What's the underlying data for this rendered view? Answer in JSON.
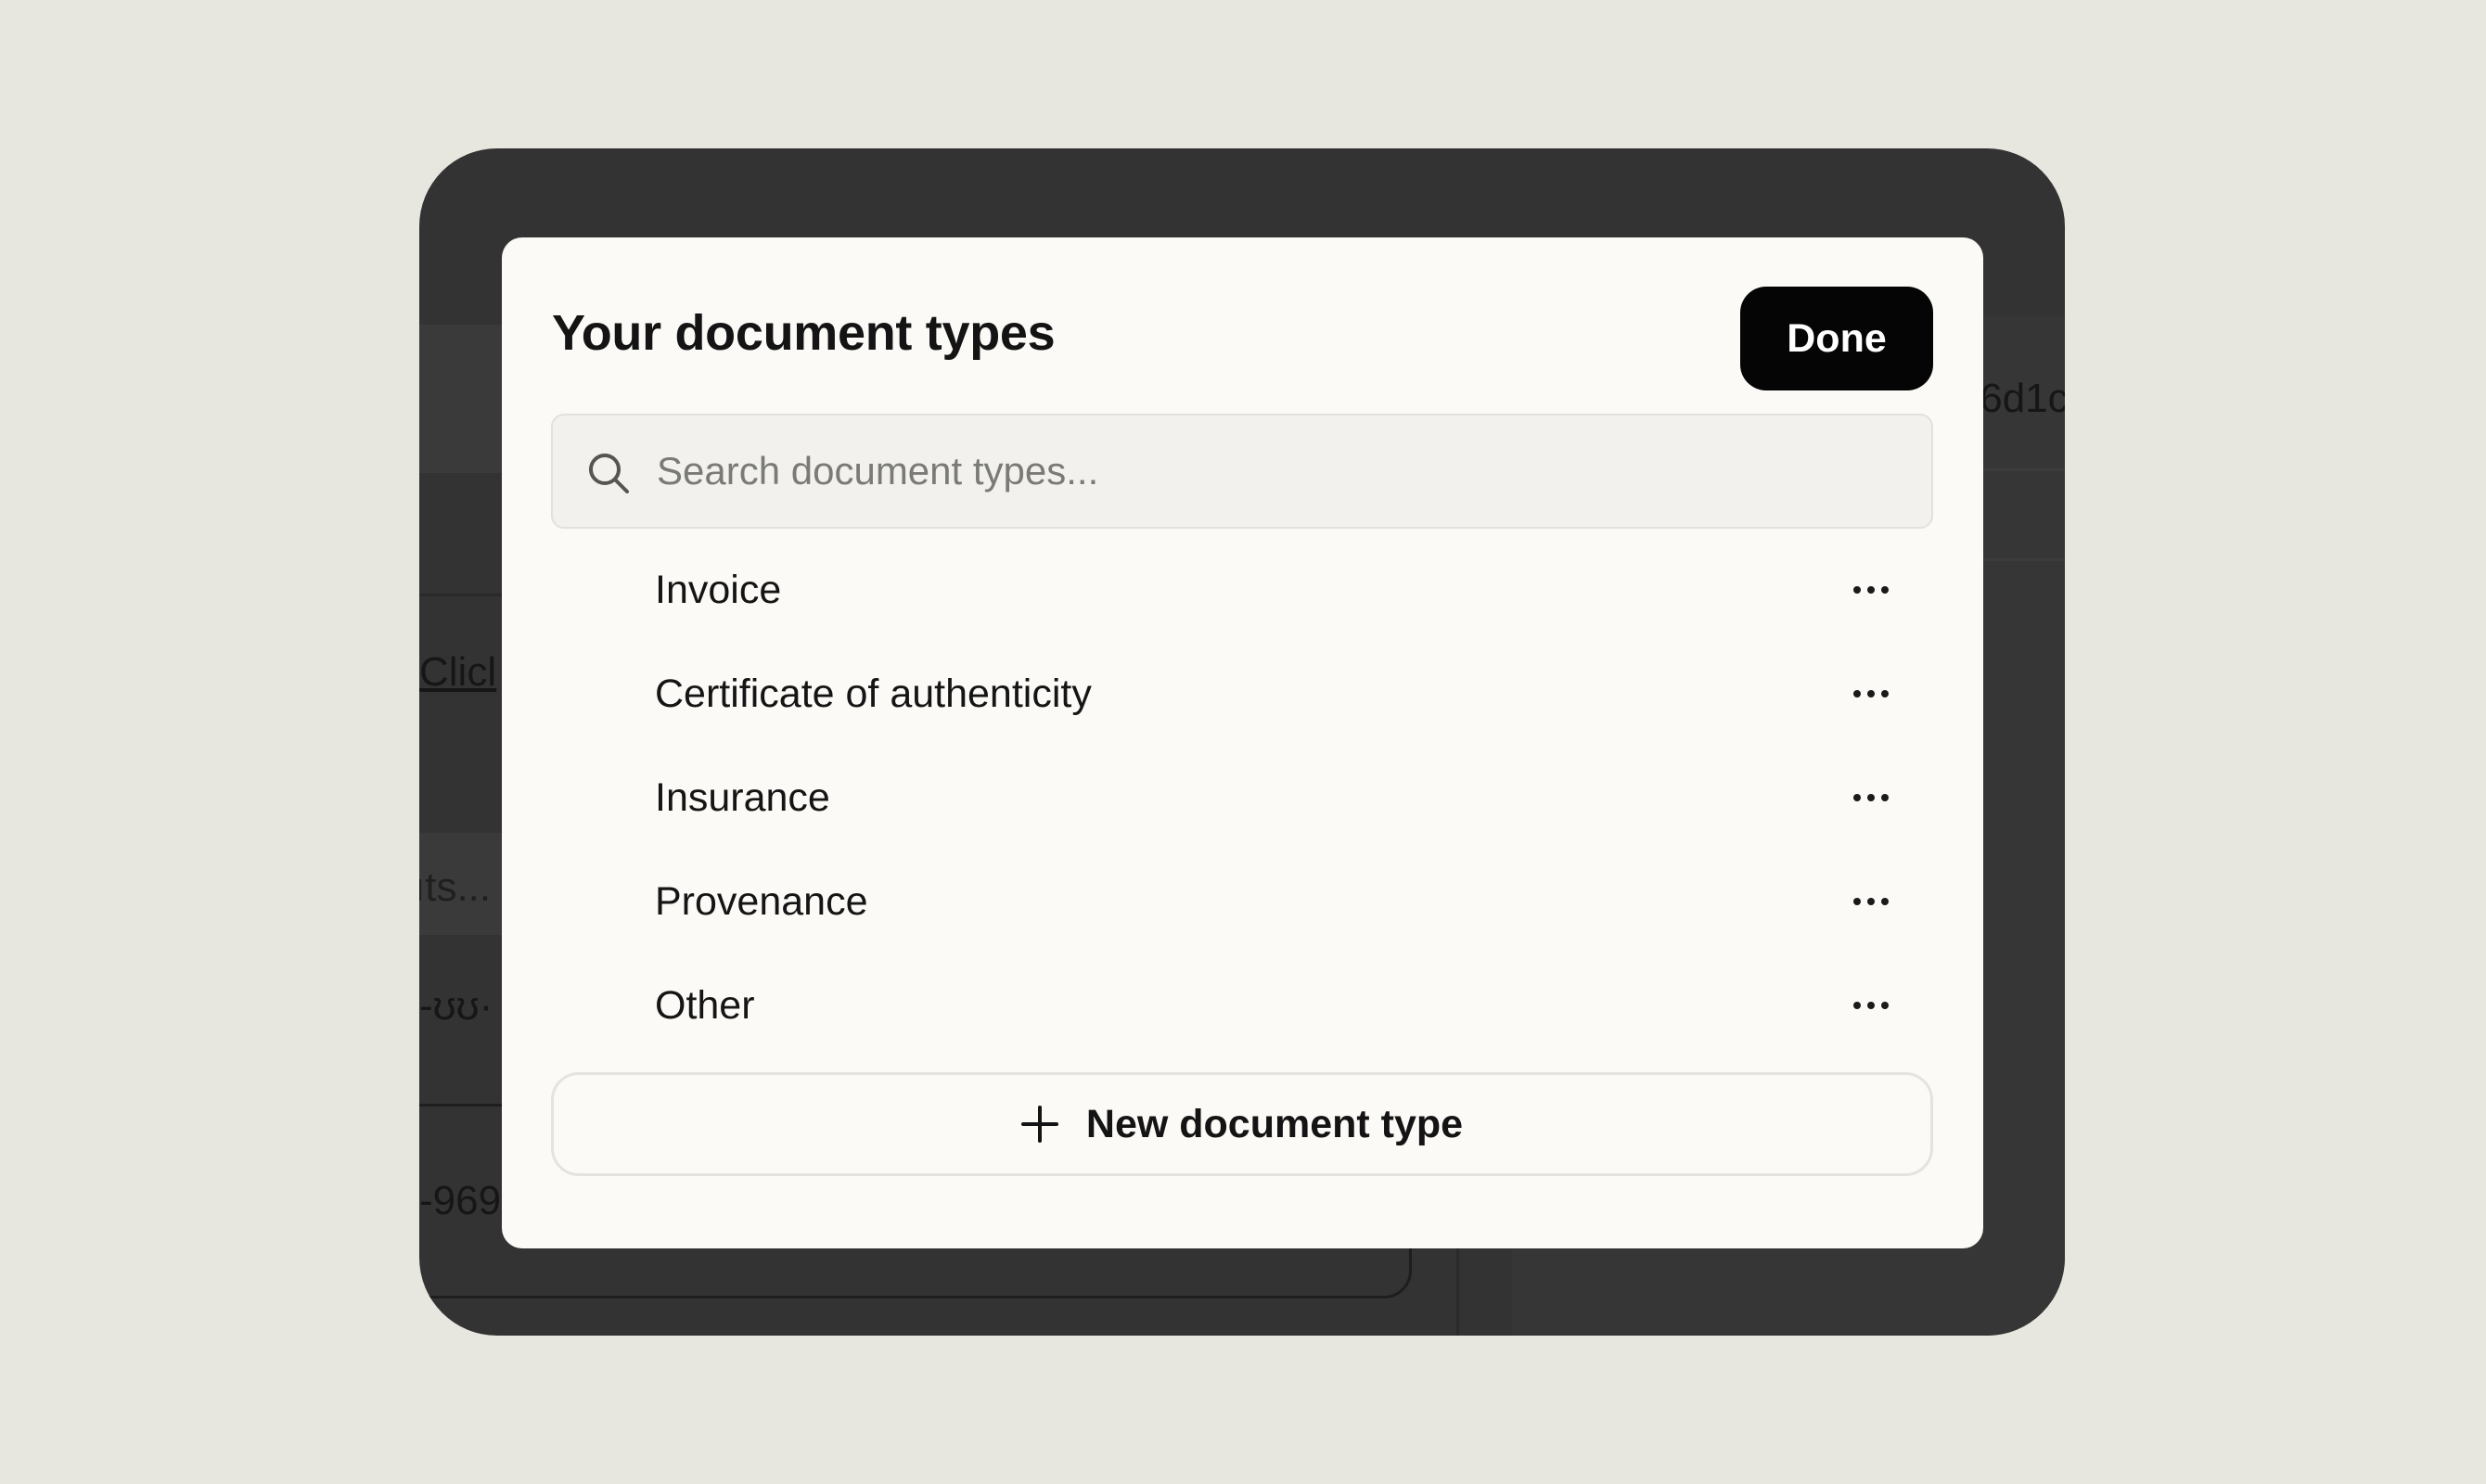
{
  "modal": {
    "title": "Your document types",
    "done_label": "Done",
    "search": {
      "placeholder": "Search document types...",
      "value": ""
    },
    "types": [
      {
        "label": "Invoice"
      },
      {
        "label": "Certificate of authenticity"
      },
      {
        "label": "Insurance"
      },
      {
        "label": "Provenance"
      },
      {
        "label": "Other"
      }
    ],
    "new_type_label": "New document type"
  },
  "background": {
    "link_fragment": "Clicl",
    "input_fragment": "ıts...",
    "truncated_fragment": "-969",
    "hash_fragment": ".6d1c",
    "cut_text_fragment": "-ʊʊ·"
  },
  "icons": {
    "search": "search-icon",
    "more": "more-horizontal-icon",
    "plus": "plus-icon"
  },
  "colors": {
    "page_bg": "#e8e7df",
    "frame": "#333333",
    "modal_bg": "#fbfaf7",
    "primary_button": "#050505"
  }
}
